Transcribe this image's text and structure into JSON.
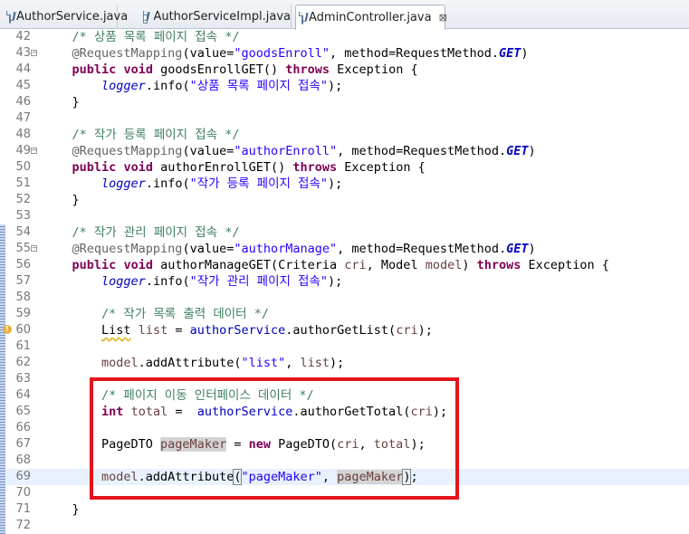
{
  "tabs": [
    {
      "label": "AuthorService.java",
      "active": false,
      "closable": false
    },
    {
      "label": "AuthorServiceImpl.java",
      "active": false,
      "closable": false
    },
    {
      "label": "AdminController.java",
      "active": true,
      "closable": true
    }
  ],
  "file_icon_glyph": "J",
  "close_glyph": "⊠",
  "colors": {
    "keyword": "#7f0055",
    "comment": "#3f7f5f",
    "string": "#2a00ff",
    "annotation": "#646464",
    "field": "#0000c0",
    "highlight_box": "#e3141b",
    "current_line": "#e8f2fe"
  },
  "lines": [
    {
      "num": "42",
      "tokens": [
        [
          "    ",
          ""
        ],
        [
          "/* 상품 목록 페이지 접속 */",
          "cm"
        ]
      ]
    },
    {
      "num": "43",
      "fold": "collapse",
      "tokens": [
        [
          "    ",
          ""
        ],
        [
          "@RequestMapping",
          "ann"
        ],
        [
          "(value=",
          ""
        ],
        [
          "\"goodsEnroll\"",
          "str"
        ],
        [
          ", method=RequestMethod.",
          ""
        ],
        [
          "GET",
          "const"
        ],
        [
          ")",
          ""
        ]
      ]
    },
    {
      "num": "44",
      "tokens": [
        [
          "    ",
          ""
        ],
        [
          "public",
          "kw"
        ],
        [
          " ",
          ""
        ],
        [
          "void",
          "kw"
        ],
        [
          " goodsEnrollGET() ",
          ""
        ],
        [
          "throws",
          "kw"
        ],
        [
          " Exception {",
          ""
        ]
      ]
    },
    {
      "num": "45",
      "tokens": [
        [
          "        ",
          ""
        ],
        [
          "logger",
          "sfi"
        ],
        [
          ".info(",
          ""
        ],
        [
          "\"상품 목록 페이지 접속\"",
          "str"
        ],
        [
          ");",
          ""
        ]
      ]
    },
    {
      "num": "46",
      "tokens": [
        [
          "    }",
          ""
        ]
      ]
    },
    {
      "num": "47",
      "tokens": []
    },
    {
      "num": "48",
      "tokens": [
        [
          "    ",
          ""
        ],
        [
          "/* 작가 등록 페이지 접속 */",
          "cm"
        ]
      ]
    },
    {
      "num": "49",
      "fold": "collapse",
      "tokens": [
        [
          "    ",
          ""
        ],
        [
          "@RequestMapping",
          "ann"
        ],
        [
          "(value=",
          ""
        ],
        [
          "\"authorEnroll\"",
          "str"
        ],
        [
          ", method=RequestMethod.",
          ""
        ],
        [
          "GET",
          "const"
        ],
        [
          ")",
          ""
        ]
      ]
    },
    {
      "num": "50",
      "tokens": [
        [
          "    ",
          ""
        ],
        [
          "public",
          "kw"
        ],
        [
          " ",
          ""
        ],
        [
          "void",
          "kw"
        ],
        [
          " authorEnrollGET() ",
          ""
        ],
        [
          "throws",
          "kw"
        ],
        [
          " Exception {",
          ""
        ]
      ]
    },
    {
      "num": "51",
      "tokens": [
        [
          "        ",
          ""
        ],
        [
          "logger",
          "sfi"
        ],
        [
          ".info(",
          ""
        ],
        [
          "\"작가 등록 페이지 접속\"",
          "str"
        ],
        [
          ");",
          ""
        ]
      ]
    },
    {
      "num": "52",
      "tokens": [
        [
          "    }",
          ""
        ]
      ]
    },
    {
      "num": "53",
      "tokens": []
    },
    {
      "num": "54",
      "ruler": true,
      "tokens": [
        [
          "    ",
          ""
        ],
        [
          "/* 작가 관리 페이지 접속 */",
          "cm"
        ]
      ]
    },
    {
      "num": "55",
      "ruler": true,
      "fold": "collapse",
      "tokens": [
        [
          "    ",
          ""
        ],
        [
          "@RequestMapping",
          "ann"
        ],
        [
          "(value=",
          ""
        ],
        [
          "\"authorManage\"",
          "str"
        ],
        [
          ", method=RequestMethod.",
          ""
        ],
        [
          "GET",
          "const"
        ],
        [
          ")",
          ""
        ]
      ]
    },
    {
      "num": "56",
      "ruler": true,
      "tokens": [
        [
          "    ",
          ""
        ],
        [
          "public",
          "kw"
        ],
        [
          " ",
          ""
        ],
        [
          "void",
          "kw"
        ],
        [
          " authorManageGET(Criteria ",
          ""
        ],
        [
          "cri",
          "var"
        ],
        [
          ", Model ",
          ""
        ],
        [
          "model",
          "var"
        ],
        [
          ") ",
          ""
        ],
        [
          "throws",
          "kw"
        ],
        [
          " Exception {",
          ""
        ]
      ]
    },
    {
      "num": "57",
      "ruler": true,
      "tokens": [
        [
          "        ",
          ""
        ],
        [
          "logger",
          "sfi"
        ],
        [
          ".info(",
          ""
        ],
        [
          "\"작가 관리 페이지 접속\"",
          "str"
        ],
        [
          ");",
          ""
        ]
      ]
    },
    {
      "num": "58",
      "ruler": true,
      "tokens": []
    },
    {
      "num": "59",
      "ruler": true,
      "tokens": [
        [
          "        ",
          ""
        ],
        [
          "/* 작가 목록 출력 데이터 */",
          "cm"
        ]
      ]
    },
    {
      "num": "60",
      "ruler": true,
      "warning": true,
      "tokens": [
        [
          "        ",
          ""
        ],
        [
          "List",
          "warn"
        ],
        [
          " ",
          ""
        ],
        [
          "list",
          "var"
        ],
        [
          " = ",
          ""
        ],
        [
          "authorService",
          "fld"
        ],
        [
          ".authorGetList(",
          ""
        ],
        [
          "cri",
          "var"
        ],
        [
          ");",
          ""
        ]
      ]
    },
    {
      "num": "61",
      "ruler": true,
      "tokens": []
    },
    {
      "num": "62",
      "ruler": true,
      "tokens": [
        [
          "        ",
          ""
        ],
        [
          "model",
          "var"
        ],
        [
          ".addAttribute(",
          ""
        ],
        [
          "\"list\"",
          "str"
        ],
        [
          ", ",
          ""
        ],
        [
          "list",
          "var"
        ],
        [
          ");",
          ""
        ]
      ]
    },
    {
      "num": "63",
      "ruler": true,
      "tokens": []
    },
    {
      "num": "64",
      "ruler": true,
      "tokens": [
        [
          "        ",
          ""
        ],
        [
          "/* 페이지 이동 인터페이스 데이터 */",
          "cm"
        ]
      ]
    },
    {
      "num": "65",
      "ruler": true,
      "tokens": [
        [
          "        ",
          ""
        ],
        [
          "int",
          "kw"
        ],
        [
          " ",
          ""
        ],
        [
          "total",
          "var"
        ],
        [
          " =  ",
          ""
        ],
        [
          "authorService",
          "fld"
        ],
        [
          ".authorGetTotal(",
          ""
        ],
        [
          "cri",
          "var"
        ],
        [
          ");",
          ""
        ]
      ]
    },
    {
      "num": "66",
      "ruler": true,
      "tokens": []
    },
    {
      "num": "67",
      "ruler": true,
      "tokens": [
        [
          "        PageDTO ",
          ""
        ],
        [
          "pageMaker",
          "var hl"
        ],
        [
          " = ",
          ""
        ],
        [
          "new",
          "kw"
        ],
        [
          " PageDTO(",
          ""
        ],
        [
          "cri",
          "var"
        ],
        [
          ", ",
          ""
        ],
        [
          "total",
          "var"
        ],
        [
          ");",
          ""
        ]
      ]
    },
    {
      "num": "68",
      "ruler": true,
      "tokens": []
    },
    {
      "num": "69",
      "ruler": true,
      "current": true,
      "tokens": [
        [
          "        ",
          ""
        ],
        [
          "model",
          "var"
        ],
        [
          ".addAttribute",
          ""
        ],
        [
          "(",
          "bracket"
        ],
        [
          "\"pageMaker\"",
          "str"
        ],
        [
          ", ",
          ""
        ],
        [
          "pageMaker",
          "var hl"
        ],
        [
          ")",
          "bracket"
        ],
        [
          ";",
          ""
        ]
      ]
    },
    {
      "num": "70",
      "ruler": true,
      "tokens": []
    },
    {
      "num": "71",
      "ruler": true,
      "tokens": [
        [
          "    }",
          ""
        ]
      ]
    },
    {
      "num": "72",
      "ruler": true,
      "tokens": []
    }
  ]
}
